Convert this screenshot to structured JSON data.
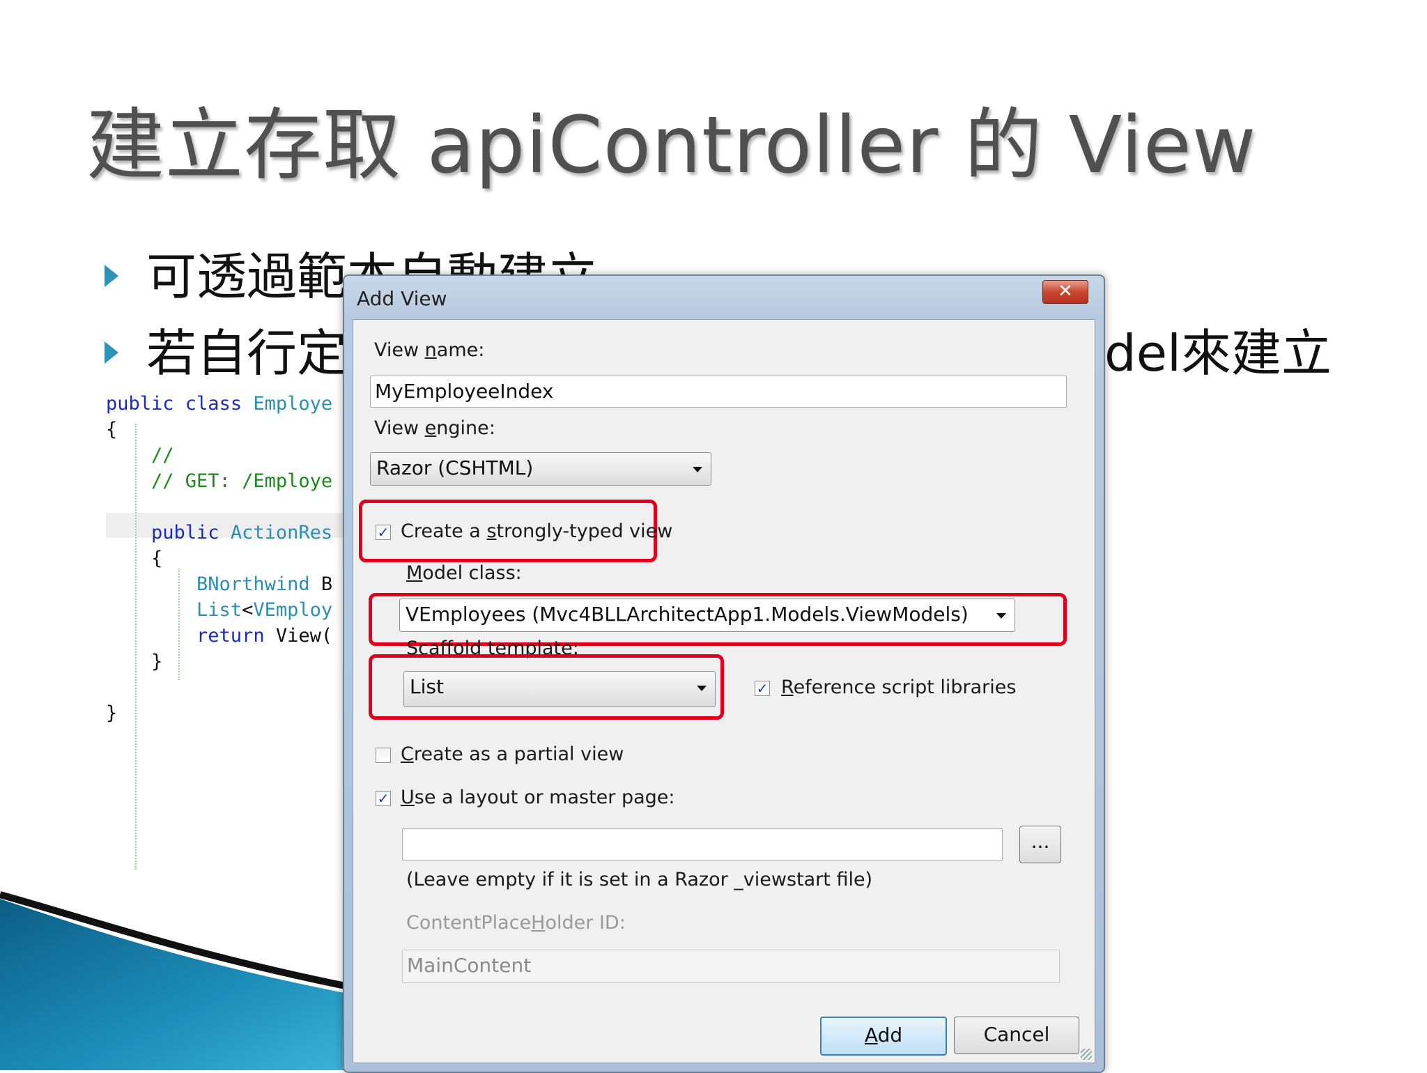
{
  "slide": {
    "title": "建立存取 apiController 的 View",
    "bullet1": "可透過範本自動建立",
    "bullet2_visible_start": "若自行定",
    "bullet2_visible_end": "del來建立"
  },
  "code_lines": [
    {
      "parts": [
        {
          "cls": "kw",
          "t": "public "
        },
        {
          "cls": "kw",
          "t": "class "
        },
        {
          "cls": "ty",
          "t": "Employe"
        }
      ]
    },
    {
      "parts": [
        {
          "cls": "tx",
          "t": "{"
        }
      ]
    },
    {
      "parts": [
        {
          "cls": "cm",
          "t": "    //"
        }
      ]
    },
    {
      "parts": [
        {
          "cls": "cm",
          "t": "    // GET: /Employe"
        }
      ]
    },
    {
      "parts": [
        {
          "cls": "cm",
          "t": ""
        }
      ]
    },
    {
      "parts": [
        {
          "cls": "kw",
          "t": "    public "
        },
        {
          "cls": "ty",
          "t": "ActionRes"
        }
      ]
    },
    {
      "parts": [
        {
          "cls": "tx",
          "t": "    {"
        }
      ]
    },
    {
      "parts": [
        {
          "cls": "ty",
          "t": "        BNorthwind "
        },
        {
          "cls": "tx",
          "t": "B"
        }
      ]
    },
    {
      "parts": [
        {
          "cls": "ty",
          "t": "        List"
        },
        {
          "cls": "tx",
          "t": "<"
        },
        {
          "cls": "ty",
          "t": "VEmploy"
        }
      ]
    },
    {
      "parts": [
        {
          "cls": "kw",
          "t": "        return "
        },
        {
          "cls": "tx",
          "t": "View("
        }
      ]
    },
    {
      "parts": [
        {
          "cls": "tx",
          "t": "    }"
        }
      ]
    },
    {
      "parts": [
        {
          "cls": "tx",
          "t": ""
        }
      ]
    },
    {
      "parts": [
        {
          "cls": "tx",
          "t": "}"
        }
      ]
    }
  ],
  "dialog": {
    "title": "Add View",
    "close_glyph": "✕",
    "view_name_label": {
      "pre": "View ",
      "u": "n",
      "post": "ame:"
    },
    "view_name_value": "MyEmployeeIndex",
    "view_engine_label": {
      "pre": "View ",
      "u": "e",
      "post": "ngine:"
    },
    "view_engine_value": "Razor (CSHTML)",
    "strongly_typed_label": {
      "pre": "Create a ",
      "u": "s",
      "post": "trongly-typed view"
    },
    "strongly_typed_checked": true,
    "model_class_label": {
      "pre": "",
      "u": "M",
      "post": "odel class:"
    },
    "model_class_value": "VEmployees (Mvc4BLLArchitectApp1.Models.ViewModels)",
    "scaffold_label": "Scaffold template:",
    "scaffold_value": "List",
    "reference_scripts_label": {
      "pre": "",
      "u": "R",
      "post": "eference script libraries"
    },
    "reference_scripts_checked": true,
    "partial_view_label": {
      "pre": "",
      "u": "C",
      "post": "reate as a partial view"
    },
    "partial_view_checked": false,
    "layout_label": {
      "pre": "",
      "u": "U",
      "post": "se a layout or master page:"
    },
    "layout_checked": true,
    "layout_value": "",
    "browse_label": "...",
    "layout_hint": "(Leave empty if it is set in a Razor _viewstart file)",
    "placeholder_label": {
      "pre": "ContentPlace",
      "u": "H",
      "post": "older ID:"
    },
    "placeholder_value": "MainContent",
    "add_label": {
      "pre": "",
      "u": "A",
      "post": "dd"
    },
    "cancel_label": "Cancel",
    "check_glyph": "✓"
  },
  "colors": {
    "highlight_red": "#e0001b",
    "bullet_accent": "#2e93b5"
  }
}
